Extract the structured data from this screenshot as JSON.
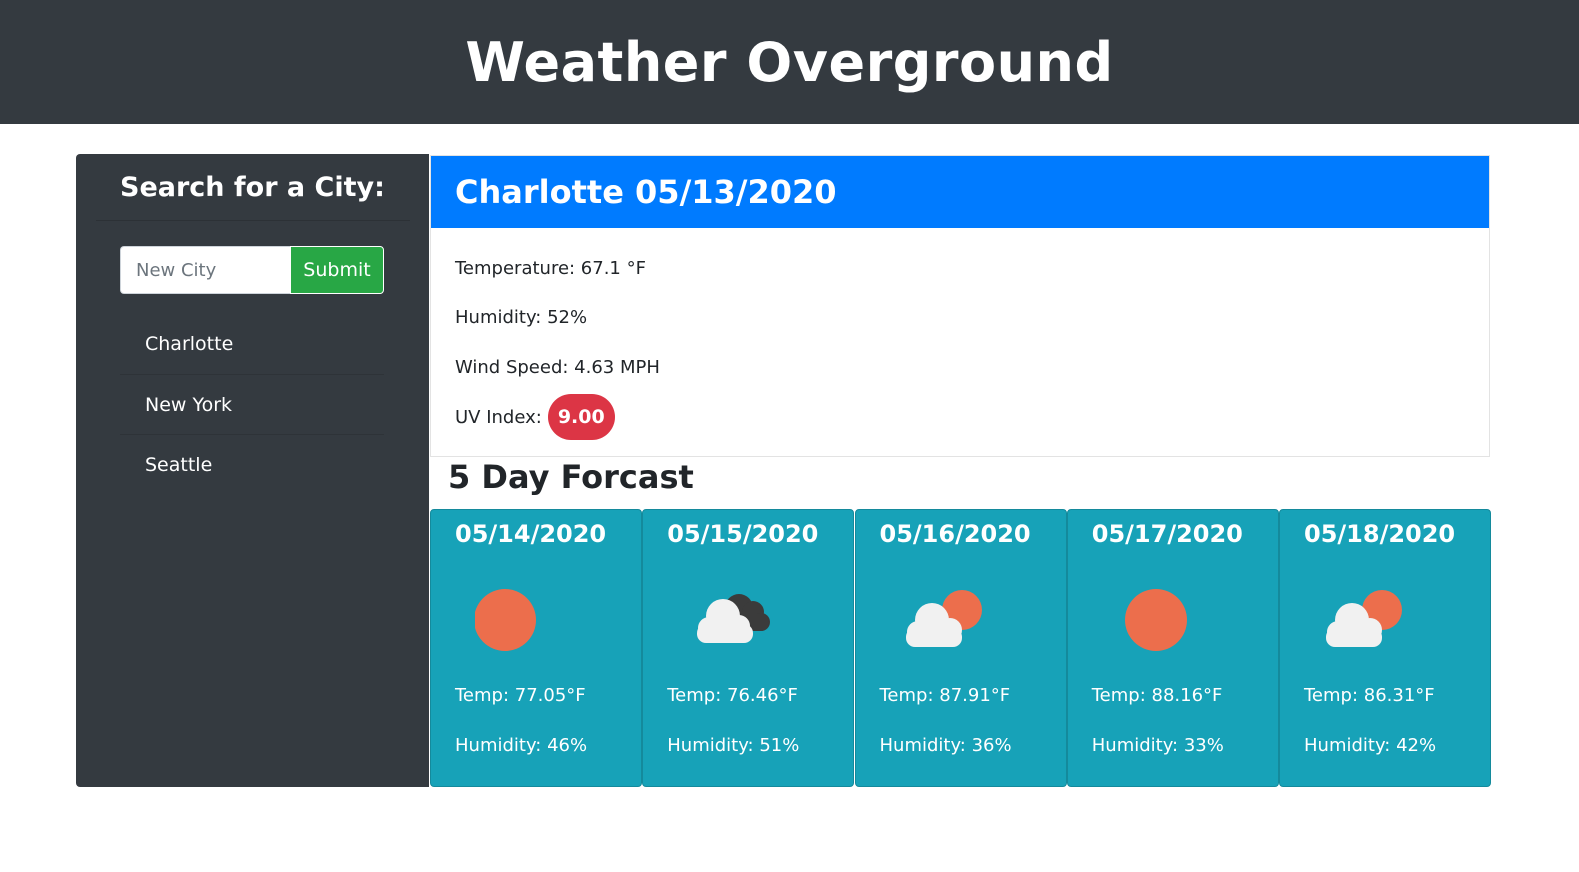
{
  "header": {
    "title": "Weather Overground"
  },
  "sidebar": {
    "heading": "Search for a City:",
    "search": {
      "placeholder": "New City",
      "value": "",
      "submit_label": "Submit"
    },
    "cities": [
      "Charlotte",
      "New York",
      "Seattle"
    ]
  },
  "current": {
    "title": "Charlotte 05/13/2020",
    "temperature": "Temperature: 67.1 °F",
    "humidity": "Humidity: 52%",
    "wind": "Wind Speed: 4.63 MPH",
    "uv_label": "UV Index:",
    "uv_value": "9.00",
    "uv_color": "#dc3545"
  },
  "forecast": {
    "title": "5 Day Forcast",
    "days": [
      {
        "date": "05/14/2020",
        "icon": "sun-icon",
        "temp": "Temp: 77.05°F",
        "humidity": "Humidity: 46%"
      },
      {
        "date": "05/15/2020",
        "icon": "broken-clouds-icon",
        "temp": "Temp: 76.46°F",
        "humidity": "Humidity: 51%"
      },
      {
        "date": "05/16/2020",
        "icon": "partly-cloudy-icon",
        "temp": "Temp: 87.91°F",
        "humidity": "Humidity: 36%"
      },
      {
        "date": "05/17/2020",
        "icon": "sun-icon",
        "temp": "Temp: 88.16°F",
        "humidity": "Humidity: 33%"
      },
      {
        "date": "05/18/2020",
        "icon": "partly-cloudy-icon",
        "temp": "Temp: 86.31°F",
        "humidity": "Humidity: 42%"
      }
    ]
  },
  "colors": {
    "header_bg": "#343a40",
    "current_header_bg": "#007bff",
    "forecast_bg": "#17a2b8",
    "submit_bg": "#28a745",
    "sun": "#ec6e4c"
  }
}
